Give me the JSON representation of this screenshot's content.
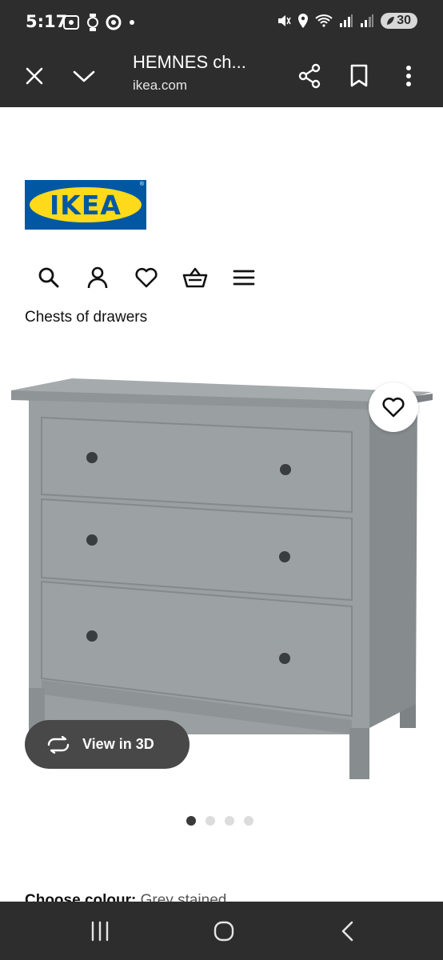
{
  "status_bar": {
    "time": "5:17",
    "battery": "30",
    "icons": [
      "screenshot-icon",
      "watch-icon",
      "circle-app-icon",
      "dot-icon",
      "mute-icon",
      "location-icon",
      "wifi-icon",
      "signal-icon",
      "signal-icon-2"
    ]
  },
  "toolbar": {
    "title": "HEMNES ch...",
    "url": "ikea.com",
    "icons": [
      "close-icon",
      "chevron-down-icon",
      "share-icon",
      "bookmark-icon",
      "more-vert-icon"
    ]
  },
  "page": {
    "logo_text": "IKEA",
    "logo_mark": "®",
    "nav_icons": [
      "search-icon",
      "account-icon",
      "heart-icon",
      "basket-icon",
      "menu-icon"
    ],
    "breadcrumb": "Chests of drawers",
    "view3d_label": "View in 3D",
    "gallery": {
      "count": 4,
      "active": 0
    },
    "colour_label": "Choose colour:",
    "colour_value": "Grey stained"
  },
  "colors": {
    "chrome": "#2d2d2d",
    "ikea_blue": "#0058a3",
    "ikea_yellow": "#ffda1a",
    "pill_bg": "#484848"
  }
}
